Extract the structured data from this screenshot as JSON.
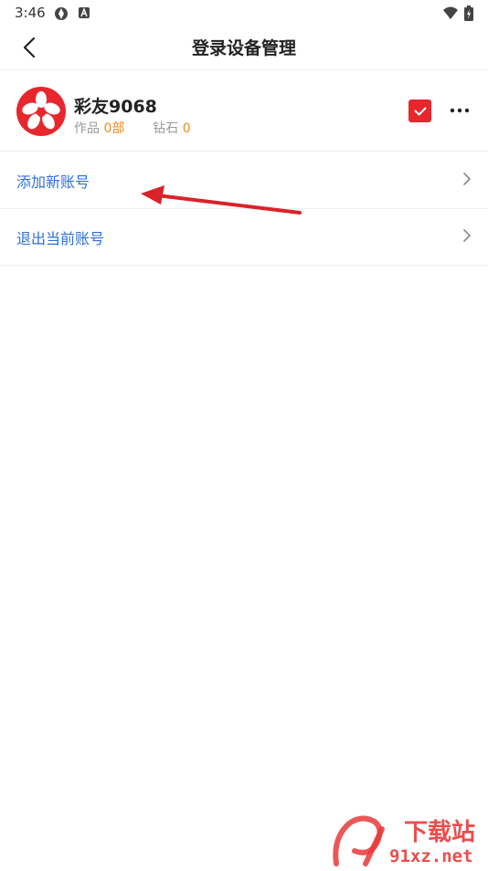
{
  "status_bar": {
    "time": "3:46"
  },
  "header": {
    "title": "登录设备管理"
  },
  "account": {
    "name": "彩友9068",
    "works_label": "作品",
    "works_value": "0部",
    "diamonds_label": "钻石",
    "diamonds_value": "0"
  },
  "menu": {
    "items": [
      {
        "label": "添加新账号"
      },
      {
        "label": "退出当前账号"
      }
    ]
  },
  "watermark": {
    "brand_text": "下载站",
    "site_text": "91xz.net"
  },
  "colors": {
    "accent_red": "#e8262d",
    "link_blue": "#2f6fd6",
    "stat_orange": "#f08a1c"
  }
}
